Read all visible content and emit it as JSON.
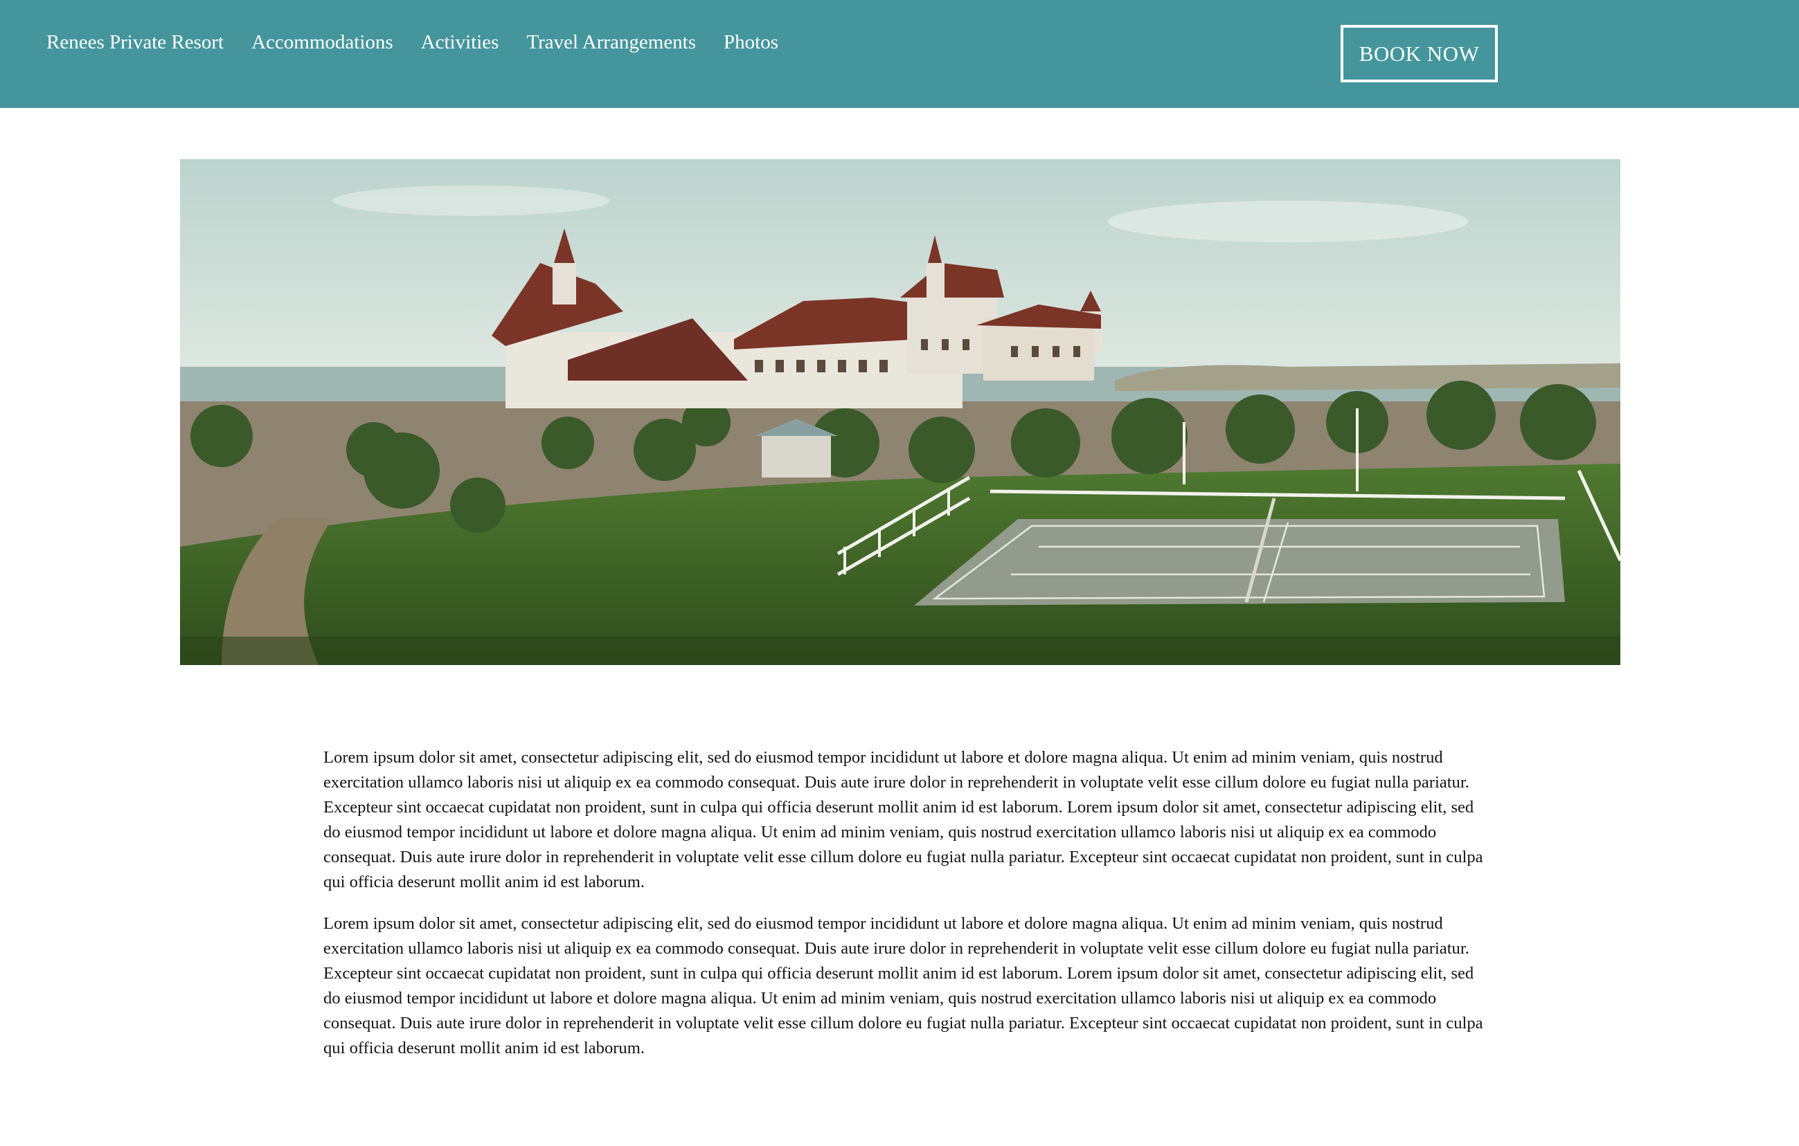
{
  "nav": {
    "brand": "Renees Private Resort",
    "links": [
      "Accommodations",
      "Activities",
      "Travel Arrangements",
      "Photos"
    ],
    "book_label": "BOOK NOW"
  },
  "colors": {
    "nav_background": "#44969c",
    "text": "#141414",
    "page_background": "#ffffff"
  },
  "hero": {
    "image_subject": "panoramic-hotel-with-lawn-and-tennis-court"
  },
  "content": {
    "paragraphs": [
      "Lorem ipsum dolor sit amet, consectetur adipiscing elit, sed do eiusmod tempor incididunt ut labore et dolore magna aliqua. Ut enim ad minim veniam, quis nostrud exercitation ullamco laboris nisi ut aliquip ex ea commodo consequat. Duis aute irure dolor in reprehenderit in voluptate velit esse cillum dolore eu fugiat nulla pariatur. Excepteur sint occaecat cupidatat non proident, sunt in culpa qui officia deserunt mollit anim id est laborum. Lorem ipsum dolor sit amet, consectetur adipiscing elit, sed do eiusmod tempor incididunt ut labore et dolore magna aliqua. Ut enim ad minim veniam, quis nostrud exercitation ullamco laboris nisi ut aliquip ex ea commodo consequat. Duis aute irure dolor in reprehenderit in voluptate velit esse cillum dolore eu fugiat nulla pariatur. Excepteur sint occaecat cupidatat non proident, sunt in culpa qui officia deserunt mollit anim id est laborum.",
      "Lorem ipsum dolor sit amet, consectetur adipiscing elit, sed do eiusmod tempor incididunt ut labore et dolore magna aliqua. Ut enim ad minim veniam, quis nostrud exercitation ullamco laboris nisi ut aliquip ex ea commodo consequat. Duis aute irure dolor in reprehenderit in voluptate velit esse cillum dolore eu fugiat nulla pariatur. Excepteur sint occaecat cupidatat non proident, sunt in culpa qui officia deserunt mollit anim id est laborum. Lorem ipsum dolor sit amet, consectetur adipiscing elit, sed do eiusmod tempor incididunt ut labore et dolore magna aliqua. Ut enim ad minim veniam, quis nostrud exercitation ullamco laboris nisi ut aliquip ex ea commodo consequat. Duis aute irure dolor in reprehenderit in voluptate velit esse cillum dolore eu fugiat nulla pariatur. Excepteur sint occaecat cupidatat non proident, sunt in culpa qui officia deserunt mollit anim id est laborum."
    ]
  }
}
